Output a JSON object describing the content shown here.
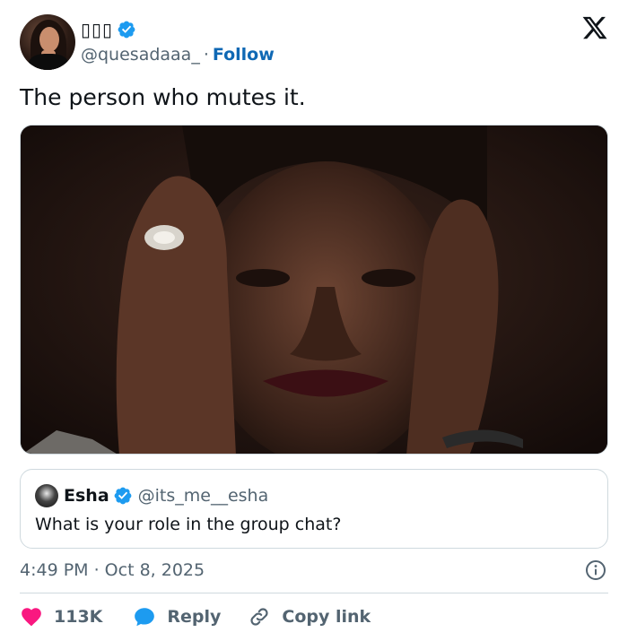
{
  "author": {
    "display_name": "▯▯▯",
    "handle": "@quesadaaa_",
    "separator": "·",
    "follow_label": "Follow"
  },
  "tweet": {
    "text": "The person who mutes it."
  },
  "quoted": {
    "name": "Esha",
    "handle": "@its_me__esha",
    "text": "What is your role in the group chat?"
  },
  "meta": {
    "timestamp": "4:49 PM · Oct 8, 2025"
  },
  "actions": {
    "likes_count": "113K",
    "reply_label": "Reply",
    "copy_link_label": "Copy link"
  },
  "colors": {
    "verified": "#1d9bf0",
    "like": "#f91880",
    "reply": "#1d9bf0",
    "follow": "#0f68b4"
  }
}
